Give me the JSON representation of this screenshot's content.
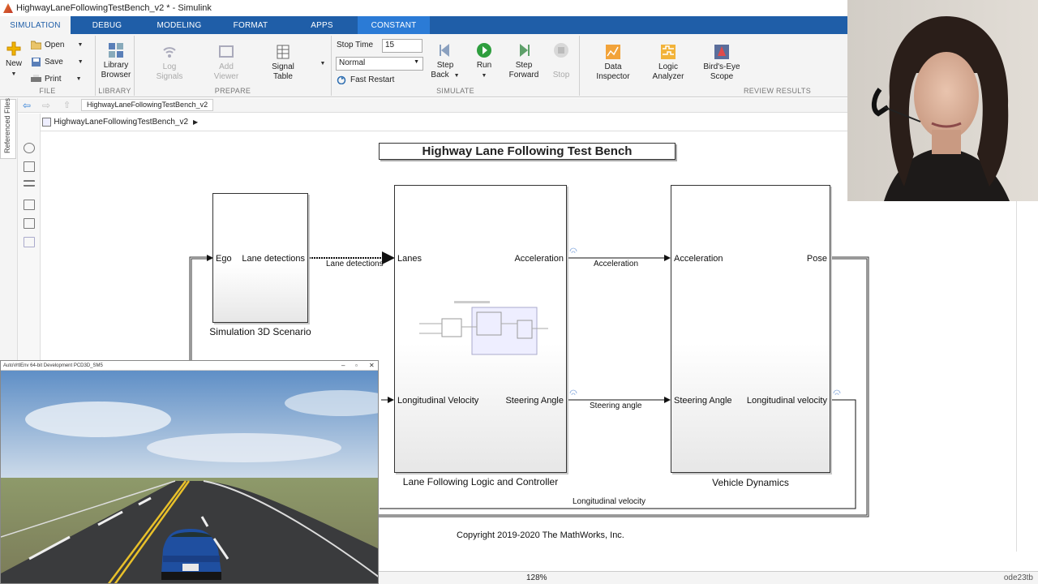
{
  "window": {
    "title": "HighwayLaneFollowingTestBench_v2 * - Simulink"
  },
  "tabs": [
    "SIMULATION",
    "DEBUG",
    "MODELING",
    "FORMAT",
    "APPS",
    "CONSTANT"
  ],
  "ribbon": {
    "file": {
      "label": "FILE",
      "new": "New",
      "open": "Open",
      "save": "Save",
      "print": "Print"
    },
    "library": {
      "label": "LIBRARY",
      "browser_line1": "Library",
      "browser_line2": "Browser"
    },
    "prepare": {
      "label": "PREPARE",
      "log_line1": "Log",
      "log_line2": "Signals",
      "add_line1": "Add",
      "add_line2": "Viewer",
      "signal_line1": "Signal",
      "signal_line2": "Table"
    },
    "simulate": {
      "label": "SIMULATE",
      "stop_time_label": "Stop Time",
      "stop_time_value": "15",
      "mode_value": "Normal",
      "fast_restart": "Fast Restart",
      "step_back_line1": "Step",
      "step_back_line2": "Back",
      "run": "Run",
      "step_fwd_line1": "Step",
      "step_fwd_line2": "Forward",
      "stop": "Stop"
    },
    "review": {
      "label": "REVIEW RESULTS",
      "data_line1": "Data",
      "data_line2": "Inspector",
      "logic_line1": "Logic",
      "logic_line2": "Analyzer",
      "birds_line1": "Bird's-Eye",
      "birds_line2": "Scope"
    }
  },
  "sidebar": {
    "referenced_files": "Referenced Files"
  },
  "doc_tab": "HighwayLaneFollowingTestBench_v2",
  "breadcrumb": "HighwayLaneFollowingTestBench_v2",
  "diagram": {
    "title": "Highway Lane Following Test Bench",
    "scenario_block": {
      "name": "Simulation 3D Scenario",
      "in_port": "Ego",
      "out_port": "Lane detections"
    },
    "controller_block": {
      "name": "Lane Following Logic and Controller",
      "in1": "Lanes",
      "in2": "Longitudinal Velocity",
      "out1": "Acceleration",
      "out2": "Steering Angle"
    },
    "dynamics_block": {
      "name": "Vehicle Dynamics",
      "in1": "Acceleration",
      "in2": "Steering Angle",
      "out1": "Pose",
      "out2": "Longitudinal velocity"
    },
    "signals": {
      "lane_detections": "Lane detections",
      "acceleration": "Acceleration",
      "steering": "Steering angle",
      "long_velocity": "Longitudinal velocity"
    },
    "copyright": "Copyright 2019-2020 The MathWorks, Inc."
  },
  "status": {
    "zoom": "128%",
    "solver": "ode23tb"
  },
  "sim_window": {
    "title": "AutoVrtlEnv 64-bit Development PCD3D_SM5"
  }
}
